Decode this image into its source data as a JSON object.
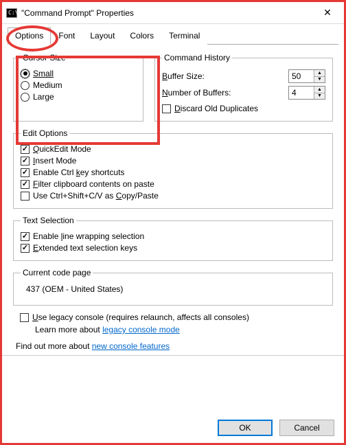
{
  "titlebar": {
    "title": "\"Command Prompt\" Properties",
    "close_icon": "✕"
  },
  "tabs": {
    "options": "Options",
    "font": "Font",
    "layout": "Layout",
    "colors": "Colors",
    "terminal": "Terminal"
  },
  "cursor": {
    "legend": "Cursor Size",
    "small": "Small",
    "medium": "Medium",
    "large": "Large"
  },
  "history": {
    "legend": "Command History",
    "buffer_size_label_pre": "B",
    "buffer_size_label_rest": "uffer Size:",
    "buffer_size_value": "50",
    "num_buffers_label_pre": "N",
    "num_buffers_label_rest": "umber of Buffers:",
    "num_buffers_value": "4",
    "discard_pre": "D",
    "discard_rest": "iscard Old Duplicates"
  },
  "edit": {
    "legend": "Edit Options",
    "quickedit_pre": "Q",
    "quickedit_rest": "uickEdit Mode",
    "insert_pre": "I",
    "insert_rest": "nsert Mode",
    "ctrl_a": "Enable Ctrl ",
    "ctrl_b": "k",
    "ctrl_c": "ey shortcuts",
    "filter_pre": "F",
    "filter_rest": "ilter clipboard contents on paste",
    "usecv_a": "Use Ctrl+Shift+C/V as ",
    "usecv_b": "C",
    "usecv_c": "opy/Paste"
  },
  "textsel": {
    "legend": "Text Selection",
    "wrap_a": "Enable ",
    "wrap_b": "l",
    "wrap_c": "ine wrapping selection",
    "ext_pre": "E",
    "ext_rest": "xtended text selection keys"
  },
  "codepage": {
    "legend": "Current code page",
    "value": "437   (OEM - United States)"
  },
  "legacy": {
    "label_pre": "U",
    "label_rest": "se legacy console (requires relaunch, affects all consoles)",
    "learn_text": "Learn more about ",
    "learn_link": "legacy console mode"
  },
  "findout": {
    "text": "Find out more about ",
    "link": "new console features"
  },
  "buttons": {
    "ok": "OK",
    "cancel": "Cancel"
  }
}
